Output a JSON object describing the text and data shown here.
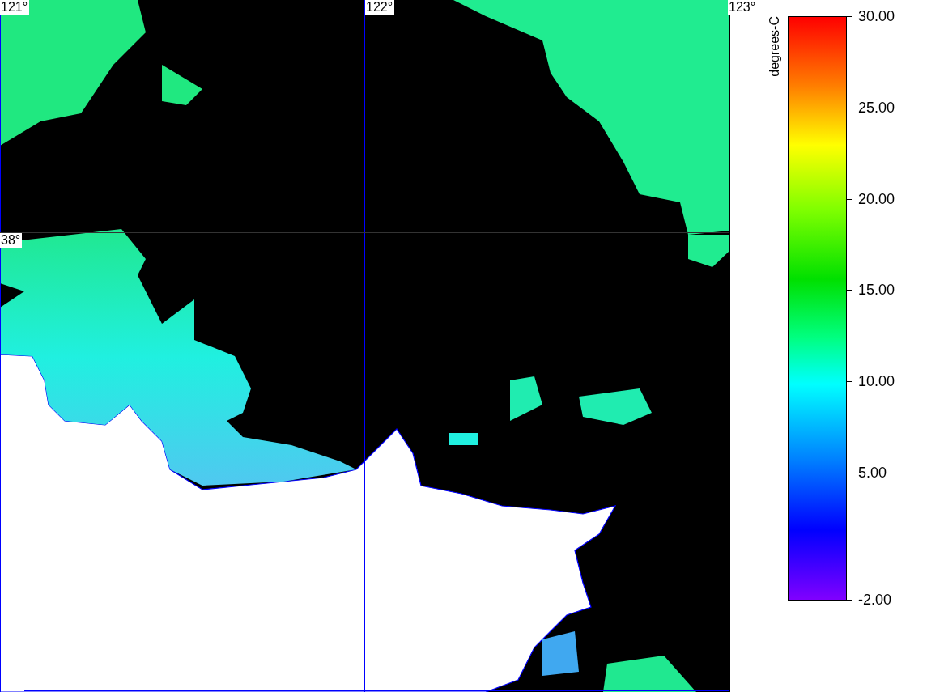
{
  "map": {
    "lon_labels": [
      "121°",
      "122°",
      "123°"
    ],
    "lat_labels": [
      "38°"
    ]
  },
  "colorbar": {
    "title": "degrees-C",
    "tick_labels": [
      "30.00",
      "25.00",
      "20.00",
      "15.00",
      "10.00",
      "5.00",
      "-2.00"
    ]
  }
}
